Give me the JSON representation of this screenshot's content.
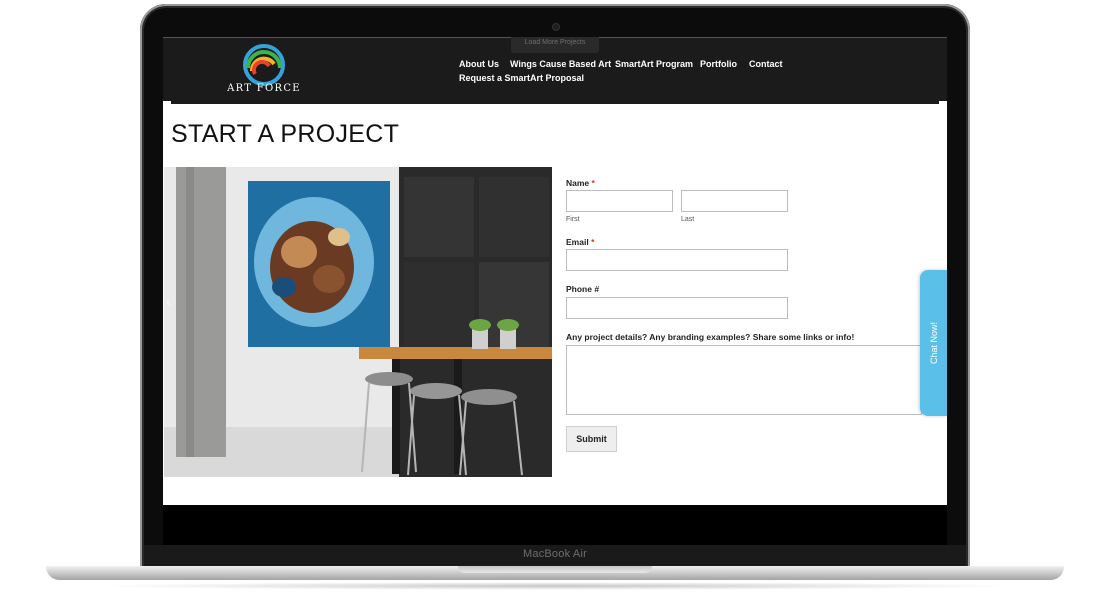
{
  "device": {
    "chin_label": "MacBook Air"
  },
  "site": {
    "logo_text": "ART FORCE",
    "logo_colors": [
      "#35a3d8",
      "#3cb54a",
      "#f5b324",
      "#e8412c"
    ],
    "load_more_tooltip": "Load More Projects",
    "nav": [
      {
        "label": "About Us"
      },
      {
        "label": "Wings Cause Based Art"
      },
      {
        "label": "SmartArt Program"
      },
      {
        "label": "Portfolio"
      },
      {
        "label": "Contact"
      },
      {
        "label": "Request a SmartArt Proposal"
      }
    ]
  },
  "page": {
    "title": "START A PROJECT"
  },
  "form": {
    "name_label": "Name",
    "required_mark": "*",
    "first_sublabel": "First",
    "last_sublabel": "Last",
    "first_value": "",
    "last_value": "",
    "email_label": "Email",
    "email_value": "",
    "phone_label": "Phone #",
    "phone_value": "",
    "details_label": "Any project details? Any branding examples? Share some links or info!",
    "details_value": "",
    "submit_label": "Submit"
  },
  "chat": {
    "label": "Chat Now!",
    "color": "#5bc0e8"
  },
  "colors": {
    "header_bg": "#1b1b1b",
    "required": "#c0392b"
  }
}
